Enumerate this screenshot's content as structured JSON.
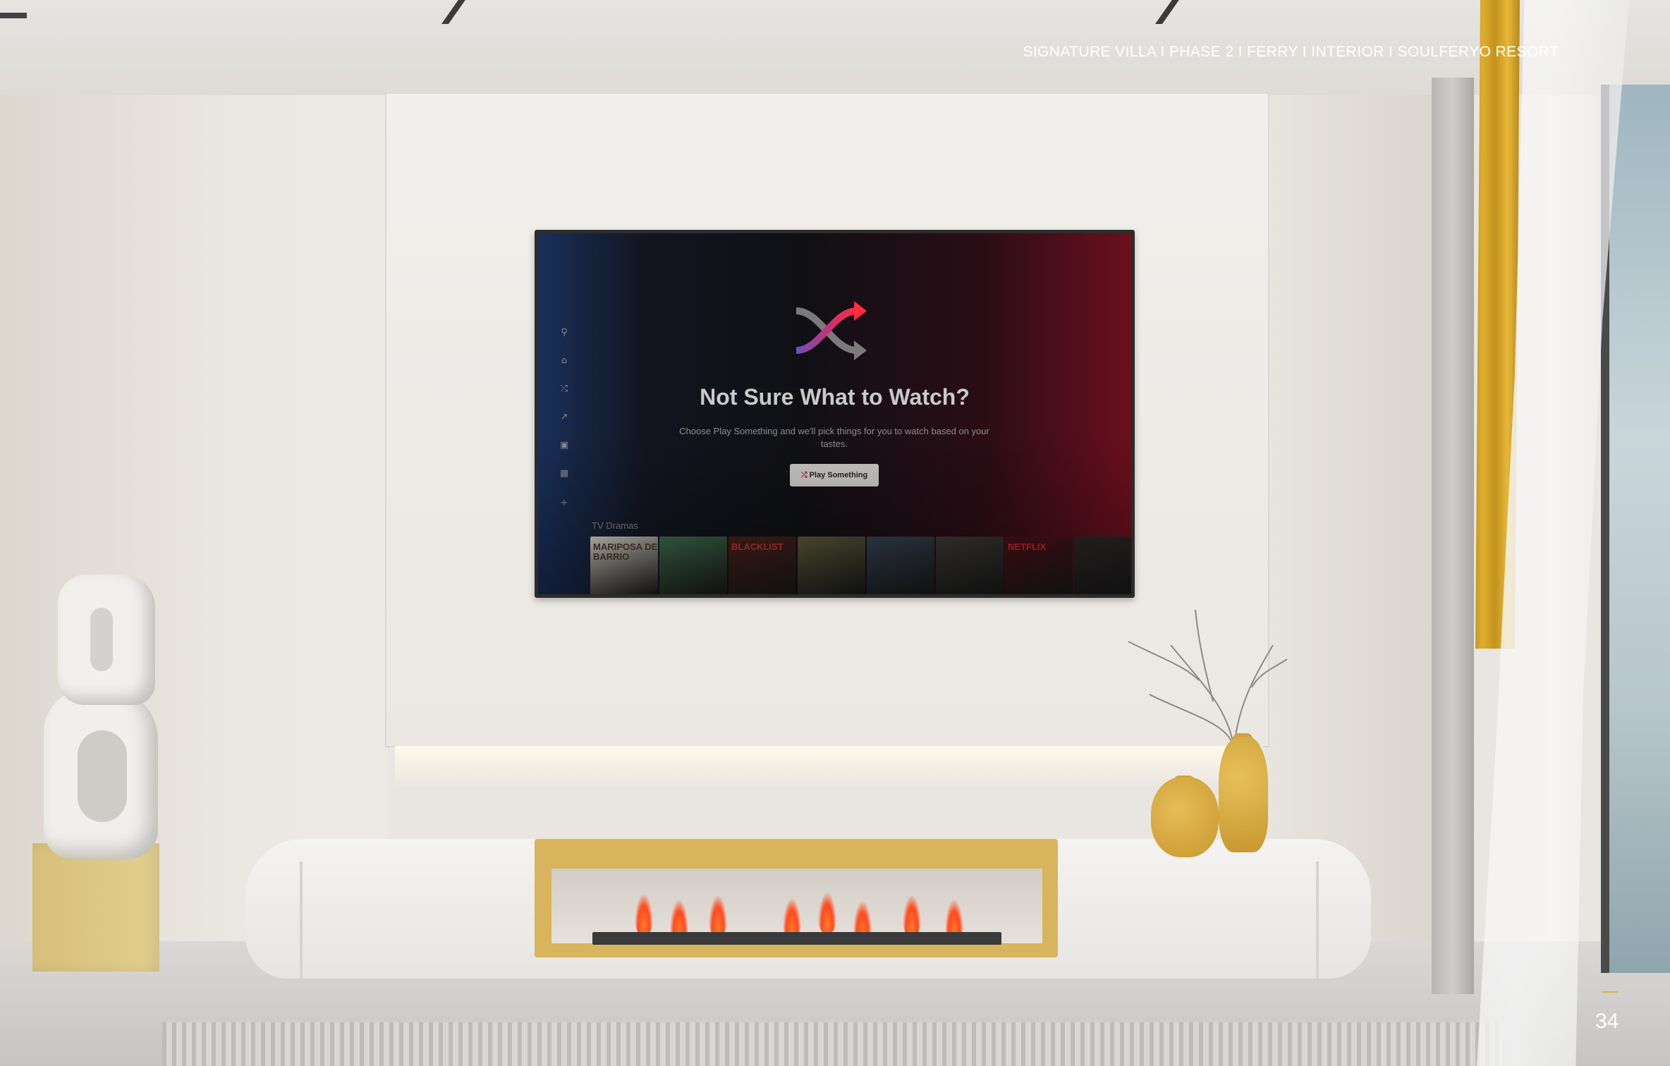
{
  "slide": {
    "header": "SIGNATURE VILLA I PHASE 2  I FERRY I INTERIOR I SOULFERYO RESORT",
    "page_number": "34"
  },
  "tv": {
    "title": "Not Sure What to Watch?",
    "subtitle": "Choose Play Something and we'll pick things for you to watch based on your tastes.",
    "play_button": "Play Something",
    "row_label": "TV Dramas",
    "nav_icons": [
      "search-icon",
      "home-icon",
      "shuffle-icon",
      "trending-icon",
      "tv-icon",
      "movie-icon",
      "plus-icon"
    ],
    "thumbnails": [
      {
        "text": "MARIPOSA DE BARRIO",
        "color": "#d7d1c6",
        "text_color": "#4a3a2a"
      },
      {
        "text": "",
        "color": "#3e6b4b",
        "text_color": "#ffffff"
      },
      {
        "text": "BLACKLIST",
        "color": "#4a1e1a",
        "text_color": "#b63a2e"
      },
      {
        "text": "",
        "color": "#5b5a3a",
        "text_color": "#ffffff"
      },
      {
        "text": "",
        "color": "#33414f",
        "text_color": "#ffffff"
      },
      {
        "text": "",
        "color": "#3a3836",
        "text_color": "#ffffff"
      },
      {
        "text": "NETFLIX",
        "color": "#4a0f14",
        "text_color": "#d11f2d"
      },
      {
        "text": "",
        "color": "#2c2626",
        "text_color": "#ffffff"
      }
    ],
    "accent_red": "#e50914"
  }
}
